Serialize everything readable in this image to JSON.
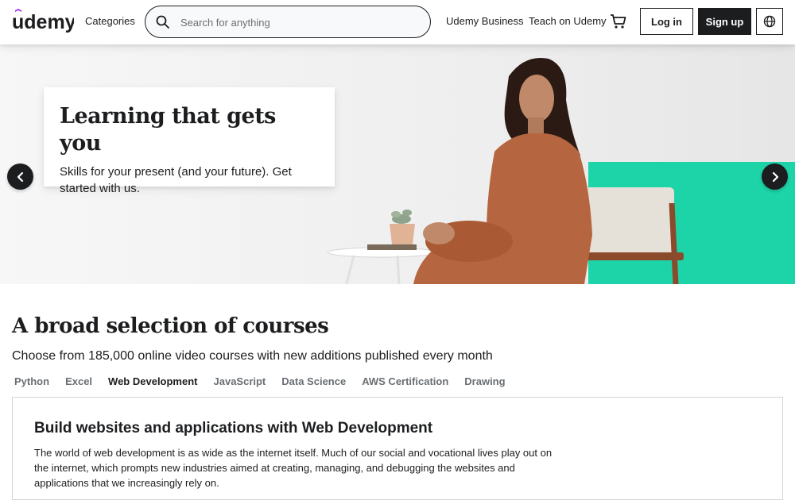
{
  "header": {
    "logo_text": "udemy",
    "categories_label": "Categories",
    "search_placeholder": "Search for anything",
    "search_value": "",
    "business_label": "Udemy Business",
    "teach_label": "Teach on Udemy",
    "login_label": "Log in",
    "signup_label": "Sign up",
    "icons": [
      "search-icon",
      "cart-icon",
      "globe-icon"
    ]
  },
  "hero": {
    "title": "Learning that gets you",
    "text": "Skills for your present (and your future). Get started with us.",
    "prev_icon": "chevron-left-icon",
    "next_icon": "chevron-right-icon"
  },
  "courses": {
    "title": "A broad selection of courses",
    "subtitle": "Choose from 185,000 online video courses with new additions published every month",
    "tabs": [
      {
        "label": "Python",
        "active": false
      },
      {
        "label": "Excel",
        "active": false
      },
      {
        "label": "Web Development",
        "active": true
      },
      {
        "label": "JavaScript",
        "active": false
      },
      {
        "label": "Data Science",
        "active": false
      },
      {
        "label": "AWS Certification",
        "active": false
      },
      {
        "label": "Drawing",
        "active": false
      }
    ],
    "panel": {
      "title": "Build websites and applications with Web Development",
      "text": "The world of web development is as wide as the internet itself. Much of our social and vocational lives play out on the internet, which prompts new industries aimed at creating, managing, and debugging the websites and applications that we increasingly rely on."
    }
  },
  "colors": {
    "brand_purple": "#a435f0",
    "text_dark": "#1c1d1f",
    "text_muted": "#6a6f73",
    "hero_accent": "#1dd4a8"
  }
}
